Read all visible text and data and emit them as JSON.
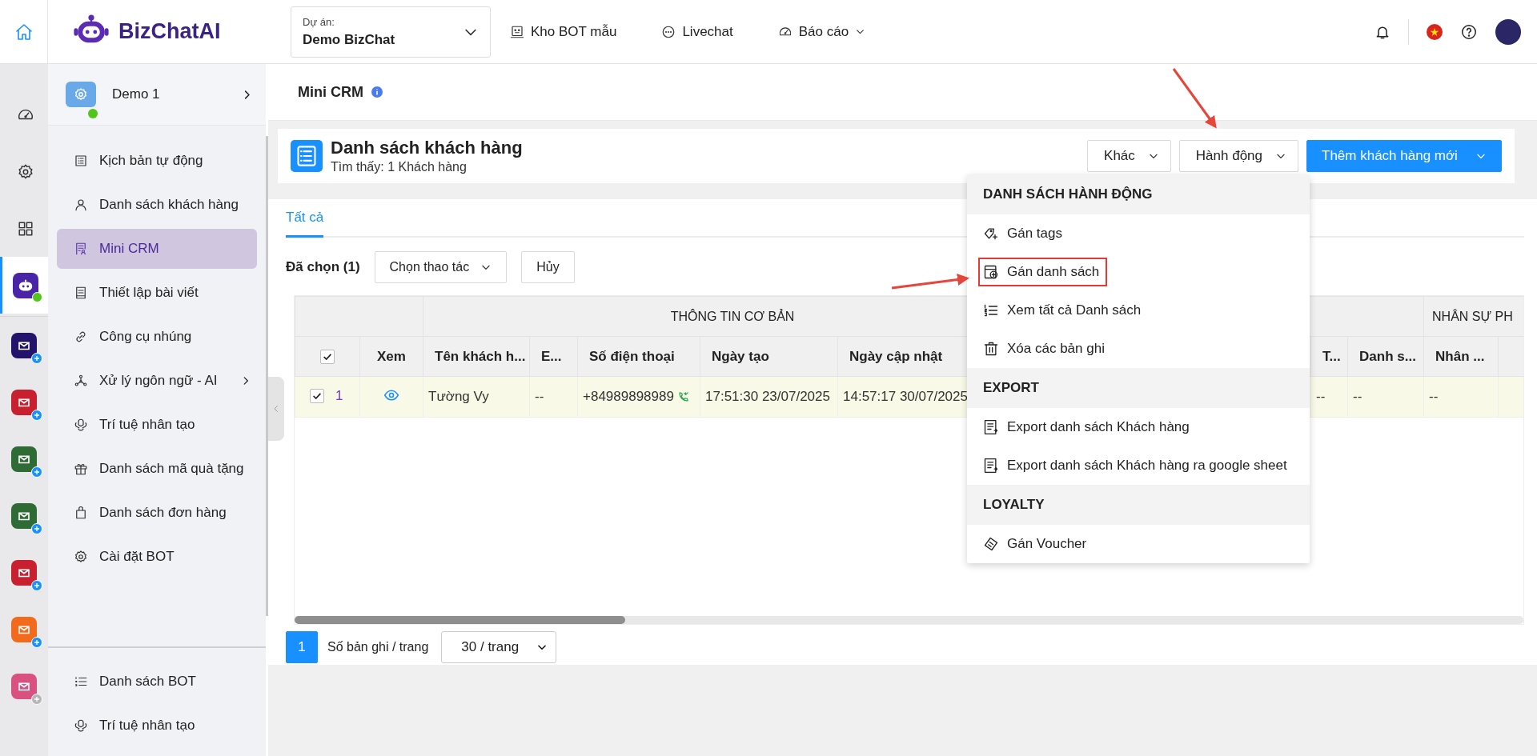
{
  "topbar": {
    "logo": "BizChatAI",
    "project": {
      "label": "Dự án:",
      "value": "Demo BizChat"
    },
    "nav": [
      {
        "label": "Kho BOT mẫu",
        "has_caret": false
      },
      {
        "label": "Livechat",
        "has_caret": false
      },
      {
        "label": "Báo cáo",
        "has_caret": true
      }
    ]
  },
  "rail": {
    "items": [
      {
        "selected": false
      },
      {
        "selected": false
      },
      {
        "selected": false
      },
      {
        "selected": true,
        "online": true
      }
    ],
    "apps": [
      {
        "color": "#24136b",
        "badge_active": true
      },
      {
        "color": "#c8202f",
        "badge_active": true
      },
      {
        "color": "#2f6b35",
        "badge_active": true
      },
      {
        "color": "#2f6b35",
        "badge_active": true
      },
      {
        "color": "#c8202f",
        "badge_active": true
      },
      {
        "color": "#f26a1b",
        "badge_active": true
      },
      {
        "color": "#d9517f",
        "badge_active": false
      }
    ]
  },
  "sidebar": {
    "bot": {
      "name": "Demo 1",
      "online": true
    },
    "items": [
      {
        "label": "Kịch bản tự động",
        "selected": false,
        "has_submenu": false
      },
      {
        "label": "Danh sách khách hàng",
        "selected": false,
        "has_submenu": false
      },
      {
        "label": "Mini CRM",
        "selected": true,
        "has_submenu": false
      },
      {
        "label": "Thiết lập bài viết",
        "selected": false,
        "has_submenu": false
      },
      {
        "label": "Công cụ nhúng",
        "selected": false,
        "has_submenu": false
      },
      {
        "label": "Xử lý ngôn ngữ - AI",
        "selected": false,
        "has_submenu": true
      },
      {
        "label": "Trí tuệ nhân tạo",
        "selected": false,
        "has_submenu": false
      },
      {
        "label": "Danh sách mã quà tặng",
        "selected": false,
        "has_submenu": false
      },
      {
        "label": "Danh sách đơn hàng",
        "selected": false,
        "has_submenu": false
      },
      {
        "label": "Cài đặt BOT",
        "selected": false,
        "has_submenu": false
      }
    ],
    "bottom_items": [
      {
        "label": "Danh sách BOT",
        "selected": false
      },
      {
        "label": "Trí tuệ nhân tạo",
        "selected": false
      }
    ]
  },
  "page": {
    "title": "Mini CRM"
  },
  "list_header": {
    "title": "Danh sách khách hàng",
    "subtitle": "Tìm thấy: 1 Khách hàng",
    "buttons": [
      {
        "label": "Khác",
        "kind": "outline"
      },
      {
        "label": "Hành động",
        "kind": "outline"
      },
      {
        "label": "Thêm khách hàng mới",
        "kind": "primary"
      }
    ]
  },
  "tabs": [
    {
      "label": "Tất cả",
      "selected": true
    }
  ],
  "selection": {
    "label": "Đã chọn (1)",
    "action_select": "Chọn thao tác",
    "cancel": "Hủy"
  },
  "table": {
    "all_checked": true,
    "groups": [
      {
        "columns": [
          {
            "kind": "checkbox"
          },
          {
            "kind": "view",
            "label": "Xem"
          }
        ]
      },
      {
        "label": "THÔNG TIN CƠ BẢN",
        "columns": [
          {
            "kind": "text",
            "label": "Tên khách h..."
          },
          {
            "kind": "text",
            "label": "E..."
          },
          {
            "kind": "phone",
            "label": "Số điện thoại"
          },
          {
            "kind": "text",
            "label": "Ngày tạo"
          },
          {
            "kind": "text",
            "label": "Ngày cập nhật"
          }
        ]
      },
      {
        "columns": [
          {
            "kind": "hidden"
          },
          {
            "kind": "text",
            "label": "T..."
          },
          {
            "kind": "text",
            "label": "Danh s..."
          }
        ]
      },
      {
        "label": "NHÂN SỰ PH",
        "columns": [
          {
            "kind": "text",
            "label": "Nhân ..."
          },
          {
            "kind": "cut"
          }
        ]
      }
    ],
    "rows": [
      {
        "selected": true,
        "number": "1",
        "cells": [
          "Tường Vy",
          "--",
          "+84989898989",
          "17:51:30 23/07/2025",
          "14:57:17 30/07/2025",
          "--",
          "--",
          "--"
        ]
      }
    ]
  },
  "pagination": {
    "pages": [
      {
        "label": "1",
        "selected": true
      }
    ],
    "page_size_label": "Số bản ghi / trang",
    "page_size": "30 / trang"
  },
  "action_menu": {
    "sections": [
      {
        "title": "DANH SÁCH HÀNH ĐỘNG",
        "items": [
          {
            "label": "Gán tags",
            "highlighted": false
          },
          {
            "label": "Gán danh sách",
            "highlighted": true
          },
          {
            "label": "Xem tất cả Danh sách",
            "highlighted": false
          },
          {
            "label": "Xóa các bản ghi",
            "highlighted": false
          }
        ]
      },
      {
        "title": "EXPORT",
        "items": [
          {
            "label": "Export danh sách Khách hàng",
            "highlighted": false
          },
          {
            "label": "Export danh sách Khách hàng ra google sheet",
            "highlighted": false
          }
        ]
      },
      {
        "title": "LOYALTY",
        "items": [
          {
            "label": "Gán Voucher",
            "highlighted": false
          }
        ]
      }
    ]
  }
}
